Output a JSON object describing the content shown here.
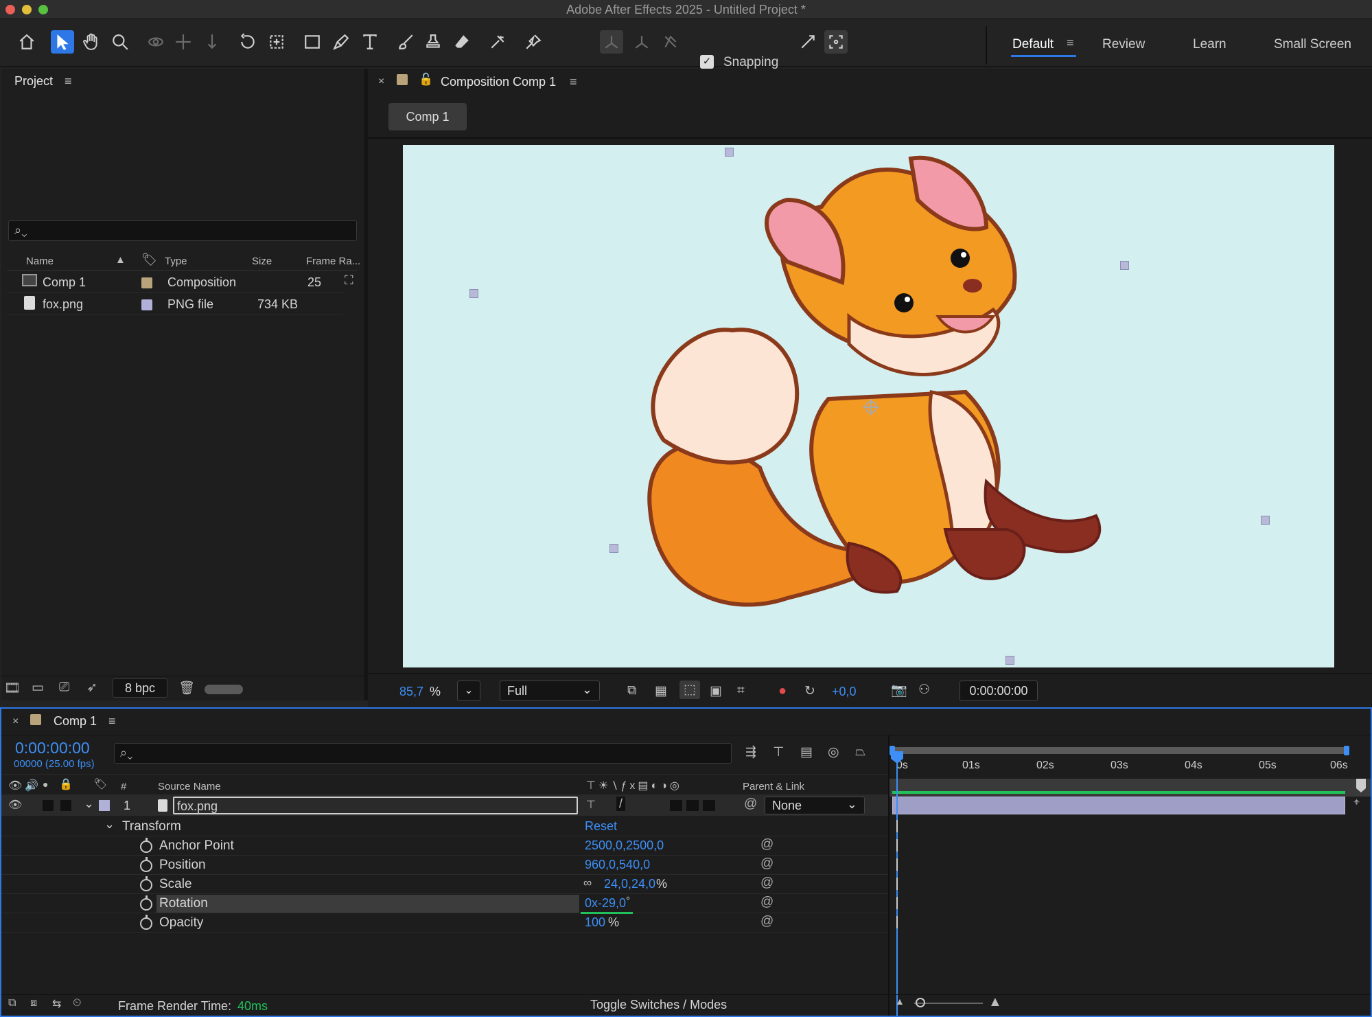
{
  "window": {
    "title": "Adobe After Effects 2025 - Untitled Project *"
  },
  "toolbar": {
    "snapping_label": "Snapping",
    "workspaces": [
      "Default",
      "Review",
      "Learn",
      "Small Screen"
    ]
  },
  "project": {
    "title": "Project",
    "columns": {
      "name": "Name",
      "type": "Type",
      "size": "Size",
      "frame_rate": "Frame Ra..."
    },
    "items": [
      {
        "name": "Comp 1",
        "type": "Composition",
        "size": "",
        "frame_rate": "25",
        "label_color": "#b8a37a"
      },
      {
        "name": "fox.png",
        "type": "PNG file",
        "size": "734 KB",
        "frame_rate": "",
        "label_color": "#b0b0d8"
      }
    ],
    "bpc": "8 bpc"
  },
  "composition": {
    "tab_title": "Composition Comp 1",
    "comp_tab": "Comp 1",
    "zoom": "85,7",
    "zoom_unit": "%",
    "resolution": "Full",
    "exposure": "+0,0",
    "timecode": "0:00:00:00",
    "background_color": "#d4efef"
  },
  "timeline": {
    "tab_title": "Comp 1",
    "current_time": "0:00:00:00",
    "frame_info": "00000 (25.00 fps)",
    "columns": {
      "number": "#",
      "source_name": "Source Name",
      "parent": "Parent & Link"
    },
    "layer": {
      "number": "1",
      "name": "fox.png",
      "parent": "None"
    },
    "transform_label": "Transform",
    "reset_label": "Reset",
    "properties": [
      {
        "name": "Anchor Point",
        "value": "2500,0,2500,0",
        "unit": ""
      },
      {
        "name": "Position",
        "value": "960,0,540,0",
        "unit": ""
      },
      {
        "name": "Scale",
        "value": "24,0,24,0",
        "unit": "%"
      },
      {
        "name": "Rotation",
        "value": "0x-29,0",
        "unit": "°"
      },
      {
        "name": "Opacity",
        "value": "100",
        "unit": "%"
      }
    ],
    "ruler": [
      "0s",
      "01s",
      "02s",
      "03s",
      "04s",
      "05s",
      "06s"
    ],
    "frame_render_label": "Frame Render Time:",
    "frame_render_value": "40ms",
    "toggle_label": "Toggle Switches / Modes"
  }
}
